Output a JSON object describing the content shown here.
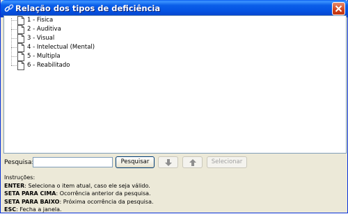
{
  "window": {
    "title": "Relação dos tipos de deficiência"
  },
  "tree": {
    "items": [
      {
        "label": "1 - Fisica"
      },
      {
        "label": "2 - Auditiva"
      },
      {
        "label": "3 - Visual"
      },
      {
        "label": "4 - Intelectual (Mental)"
      },
      {
        "label": "5 - Multipla"
      },
      {
        "label": "6 - Reabilitado"
      }
    ]
  },
  "search": {
    "label": "Pesquisa:",
    "value": "",
    "search_button": "Pesquisar",
    "next_icon": "arrow-down-icon",
    "prev_icon": "arrow-up-icon",
    "select_button": "Selecionar"
  },
  "instructions": {
    "heading": "Instruções:",
    "lines": [
      {
        "key": "ENTER",
        "text": ": Seleciona o item atual, caso ele seja válido."
      },
      {
        "key": "SETA PARA CIMA",
        "text": ": Ocorrência anterior da pesquisa."
      },
      {
        "key": "SETA PARA BAIXO",
        "text": ": Próxima ocorrência da pesquisa."
      },
      {
        "key": "ESC",
        "text": ": Fecha a janela."
      }
    ]
  },
  "colors": {
    "titlebar": "#0554e3",
    "window_bg": "#ece9d8",
    "close_button": "#d0431c"
  }
}
